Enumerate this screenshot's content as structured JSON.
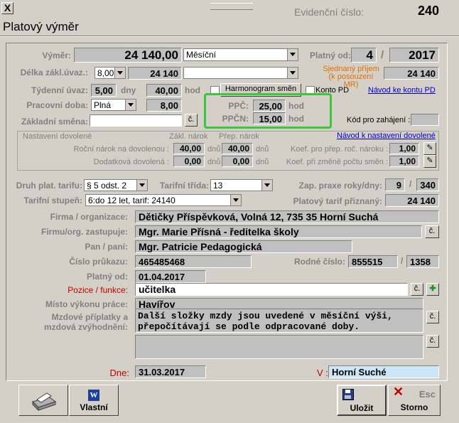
{
  "window": {
    "title": "Platový výměr",
    "close": "X"
  },
  "header": {
    "evidence_label": "Evidenční číslo:",
    "evidence_number": "240"
  },
  "row1": {
    "vymer_label": "Výměr:",
    "vymer_value": "24 140,00",
    "vymer_type": "Měsíční",
    "platny_od_label": "Platný od:",
    "platny_od_month": "4",
    "slash": "/",
    "platny_od_year": "2017"
  },
  "row2": {
    "delka_label": "Délka zákl.úvaz.:",
    "delka_select": "8,00",
    "delka_value": "24 140",
    "sjednany_label1": "Sjednaný příjem",
    "sjednany_label2": "(k posouzení MR)",
    "sjednany_value": "24 140"
  },
  "row3": {
    "tydenni_label": "Týdenní úvaz:",
    "tydenni_value": "5,00",
    "dny": "dny",
    "hod_value": "40,00",
    "hod": "hod",
    "harmonogram_btn": "Harmonogram směn",
    "konto_label": "Konto PD",
    "navod_konto": "Návod ke kontu PD"
  },
  "row4": {
    "pracovni_label": "Pracovní doba:",
    "pracovni_select": "Plná",
    "pracovni_value": "8,00"
  },
  "ppc": {
    "ppc_label": "PPČ:",
    "ppc_value": "25,00",
    "ppcn_label": "PPČN:",
    "ppcn_value": "15,00",
    "hod": "hod"
  },
  "row5": {
    "zakladni_label": "Základní směna:",
    "c_btn": "č.",
    "kod_label": "Kód pro zahájení :"
  },
  "dovolena": {
    "title": "Nastavení dovolené",
    "zakl_narok": "Zákl. nárok",
    "prep_narok": "Přep. nárok",
    "navod": "Návod k nastavení dovolené",
    "rocni_label": "Roční nárok na dovolenou :",
    "rocni_zakl": "40,00",
    "rocni_prep": "40,00",
    "dodatkova_label": "Dodatková dovolená :",
    "dod_zakl": "0,00",
    "dod_prep": "0,00",
    "dnu": "dnů",
    "koef1_label": "Koef. pro přep. roč. nároku :",
    "koef1_value": "1,00",
    "koef2_label": "Koef. při změně počtu směn :",
    "koef2_value": "1,00"
  },
  "tarif": {
    "druh_label": "Druh plat. tarifu:",
    "druh_value": "§ 5 odst. 2",
    "trida_label": "Tarifní třída:",
    "trida_value": "13",
    "praxe_label": "Zap. praxe roky/dny:",
    "praxe_roky": "9",
    "praxe_dny": "340",
    "stupen_label": "Tarifní stupeň:",
    "stupen_value": "6:do 12 let, tarif: 24140",
    "priznany_label": "Platový tarif přiznaný:",
    "priznany_value": "24 140"
  },
  "info": {
    "firma_label": "Firma / organizace:",
    "firma_value": "Dětičky Příspěvková, Volná 12, 735 35  Horní Suchá",
    "zastupuje_label": "Firmu/org. zastupuje:",
    "zastupuje_value": "Mgr. Marie Přísná - ředitelka školy",
    "pan_label": "Pan / paní:",
    "pan_value": "Mgr. Patricie  Pedagogická",
    "prukaz_label": "Číslo průkazu:",
    "prukaz_value": "465485468",
    "rodne_label": "Rodné číslo:",
    "rodne_value1": "855515",
    "rodne_value2": "1358",
    "platny_label": "Platný od:",
    "platny_value": "01.04.2017",
    "pozice_label": "Pozice / funkce:",
    "pozice_value": "učitelka",
    "misto_label": "Místo výkonu práce:",
    "misto_value": "Havířov",
    "priplatky_label1": "Mzdové příplatky a",
    "priplatky_label2": "mzdová zvýhodnění:",
    "priplatky_text1": "Další složky mzdy jsou uvedené v měsíční výši,",
    "priplatky_text2": "přepočítávají se podle odpracované doby.",
    "dne_label": "Dne:",
    "dne_value": "31.03.2017",
    "v_label": "V :",
    "v_value": "Horní Suché"
  },
  "footer": {
    "vlastni": "Vlastní",
    "ulozit": "Uložit",
    "esc": "Esc",
    "storno": "Storno"
  },
  "colors": {
    "highlight": "#3cc63c",
    "label_gray": "#808080",
    "link": "#0000cc"
  }
}
